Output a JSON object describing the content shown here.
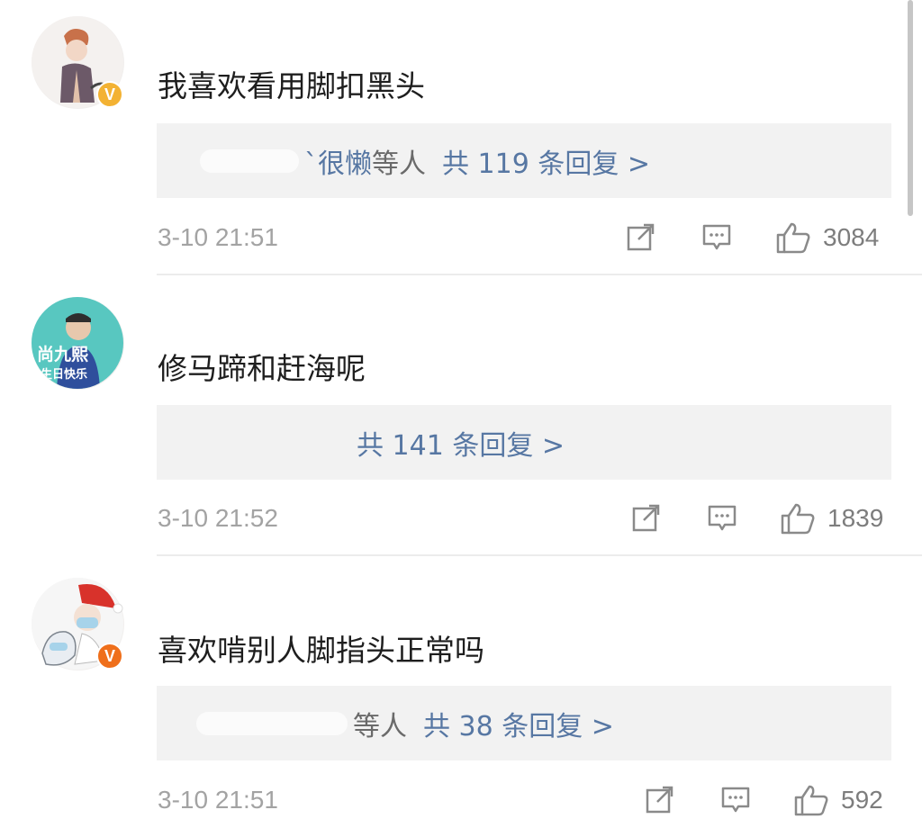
{
  "comments": [
    {
      "text": "我喜欢看用脚扣黑头",
      "badge": "V",
      "badge_color": "#f3b233",
      "replier": "`很懒",
      "and_others": "等人",
      "reply_count": "共 119 条回复 >",
      "time": "3-10 21:51",
      "likes": "3084"
    },
    {
      "text": "修马蹄和赶海呢",
      "avatar_text": [
        "尚九熙",
        "生日快乐"
      ],
      "reply_count": "共 141 条回复 >",
      "time": "3-10 21:52",
      "likes": "1839"
    },
    {
      "text": "喜欢啃别人脚指头正常吗",
      "badge": "V",
      "badge_color": "#ef6f1b",
      "and_others": "等人",
      "reply_count": "共 38 条回复 >",
      "time": "3-10 21:51",
      "likes": "592"
    }
  ],
  "icons": [
    "share-icon",
    "comment-icon",
    "like-icon"
  ],
  "colors": {
    "link": "#5777a3",
    "muted": "#a3a3a3",
    "reply_bg": "#f2f2f2"
  }
}
